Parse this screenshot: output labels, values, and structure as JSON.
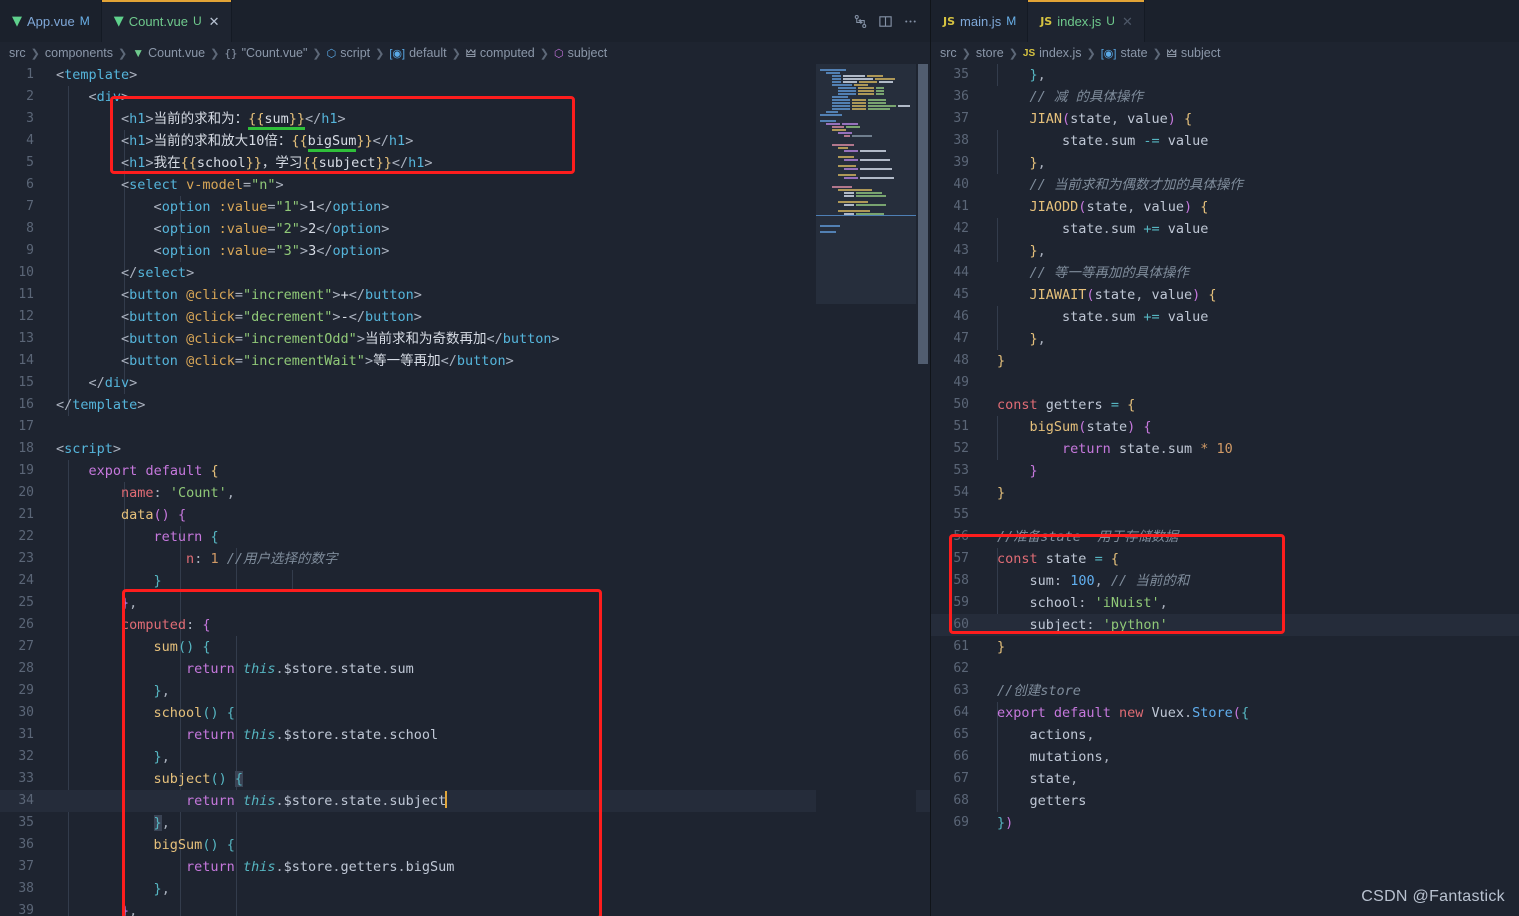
{
  "left_editor": {
    "tabs": [
      {
        "label": "App.vue",
        "icon": "vue-icon",
        "badge": "M",
        "badge_type": "modified",
        "active": false,
        "closable": false
      },
      {
        "label": "Count.vue",
        "icon": "vue-icon",
        "badge": "U",
        "badge_type": "untracked",
        "active": true,
        "closable": true
      }
    ],
    "actions": [
      {
        "name": "compare-changes-icon",
        "label": "Compare Changes"
      },
      {
        "name": "split-editor-icon",
        "label": "Split Editor"
      },
      {
        "name": "more-actions-icon",
        "label": "More Actions..."
      }
    ],
    "breadcrumb": [
      {
        "label": "src",
        "icon": "none"
      },
      {
        "label": "components",
        "icon": "none"
      },
      {
        "label": "Count.vue",
        "icon": "vue-icon"
      },
      {
        "label": "\"Count.vue\"",
        "icon": "braces-icon"
      },
      {
        "label": "script",
        "icon": "cube-icon"
      },
      {
        "label": "default",
        "icon": "object-icon"
      },
      {
        "label": "computed",
        "icon": "wrench-icon"
      },
      {
        "label": "subject",
        "icon": "field-icon"
      }
    ],
    "first_line": 1,
    "active_line": 34,
    "lines": [
      {
        "n": 1,
        "text": "<template>"
      },
      {
        "n": 2,
        "text": "    <div>"
      },
      {
        "n": 3,
        "text": "        <h1>当前的求和为：{{sum}}</h1>"
      },
      {
        "n": 4,
        "text": "        <h1>当前的求和放大10倍：{{bigSum}}</h1>"
      },
      {
        "n": 5,
        "text": "        <h1>我在{{school}}，学习{{subject}}</h1>"
      },
      {
        "n": 6,
        "text": "        <select v-model=\"n\">"
      },
      {
        "n": 7,
        "text": "            <option :value=\"1\">1</option>"
      },
      {
        "n": 8,
        "text": "            <option :value=\"2\">2</option>"
      },
      {
        "n": 9,
        "text": "            <option :value=\"3\">3</option>"
      },
      {
        "n": 10,
        "text": "        </select>"
      },
      {
        "n": 11,
        "text": "        <button @click=\"increment\">+</button>"
      },
      {
        "n": 12,
        "text": "        <button @click=\"decrement\">-</button>"
      },
      {
        "n": 13,
        "text": "        <button @click=\"incrementOdd\">当前求和为奇数再加</button>"
      },
      {
        "n": 14,
        "text": "        <button @click=\"incrementWait\">等一等再加</button>"
      },
      {
        "n": 15,
        "text": "    </div>"
      },
      {
        "n": 16,
        "text": "</template>"
      },
      {
        "n": 17,
        "text": ""
      },
      {
        "n": 18,
        "text": "<script>"
      },
      {
        "n": 19,
        "text": "    export default {"
      },
      {
        "n": 20,
        "text": "        name: 'Count',"
      },
      {
        "n": 21,
        "text": "        data() {"
      },
      {
        "n": 22,
        "text": "            return {"
      },
      {
        "n": 23,
        "text": "                n: 1 //用户选择的数字"
      },
      {
        "n": 24,
        "text": "            }"
      },
      {
        "n": 25,
        "text": "        },"
      },
      {
        "n": 26,
        "text": "        computed: {"
      },
      {
        "n": 27,
        "text": "            sum() {"
      },
      {
        "n": 28,
        "text": "                return this.$store.state.sum"
      },
      {
        "n": 29,
        "text": "            },"
      },
      {
        "n": 30,
        "text": "            school() {"
      },
      {
        "n": 31,
        "text": "                return this.$store.state.school"
      },
      {
        "n": 32,
        "text": "            },"
      },
      {
        "n": 33,
        "text": "            subject() {"
      },
      {
        "n": 34,
        "text": "                return this.$store.state.subject"
      },
      {
        "n": 35,
        "text": "            },"
      },
      {
        "n": 36,
        "text": "            bigSum() {"
      },
      {
        "n": 37,
        "text": "                return this.$store.getters.bigSum"
      },
      {
        "n": 38,
        "text": "            },"
      },
      {
        "n": 39,
        "text": "        },"
      }
    ],
    "annotations": [
      {
        "name": "template-interpolation-highlight-box",
        "color": "#fe1d1d"
      },
      {
        "name": "computed-block-highlight-box",
        "color": "#fe1d1d"
      }
    ],
    "green_underlines": [
      "sum",
      "bigSum",
      "school",
      "subject"
    ]
  },
  "right_editor": {
    "tabs": [
      {
        "label": "main.js",
        "icon": "js-icon",
        "badge": "M",
        "badge_type": "modified",
        "active": false,
        "closable": false
      },
      {
        "label": "index.js",
        "icon": "js-icon",
        "badge": "U",
        "badge_type": "untracked",
        "active": true,
        "closable": true
      }
    ],
    "breadcrumb": [
      {
        "label": "src",
        "icon": "none"
      },
      {
        "label": "store",
        "icon": "none"
      },
      {
        "label": "index.js",
        "icon": "js-icon"
      },
      {
        "label": "state",
        "icon": "object-icon"
      },
      {
        "label": "subject",
        "icon": "wrench-icon"
      }
    ],
    "first_line": 35,
    "active_line": 60,
    "lines": [
      {
        "n": 35,
        "text": "    },"
      },
      {
        "n": 36,
        "text": "    // 减 的具体操作"
      },
      {
        "n": 37,
        "text": "    JIAN(state, value) {"
      },
      {
        "n": 38,
        "text": "        state.sum -= value"
      },
      {
        "n": 39,
        "text": "    },"
      },
      {
        "n": 40,
        "text": "    // 当前求和为偶数才加的具体操作"
      },
      {
        "n": 41,
        "text": "    JIAODD(state, value) {"
      },
      {
        "n": 42,
        "text": "        state.sum += value"
      },
      {
        "n": 43,
        "text": "    },"
      },
      {
        "n": 44,
        "text": "    // 等一等再加的具体操作"
      },
      {
        "n": 45,
        "text": "    JIAWAIT(state, value) {"
      },
      {
        "n": 46,
        "text": "        state.sum += value"
      },
      {
        "n": 47,
        "text": "    },"
      },
      {
        "n": 48,
        "text": "}"
      },
      {
        "n": 49,
        "text": ""
      },
      {
        "n": 50,
        "text": "const getters = {"
      },
      {
        "n": 51,
        "text": "    bigSum(state) {"
      },
      {
        "n": 52,
        "text": "        return state.sum * 10"
      },
      {
        "n": 53,
        "text": "    }"
      },
      {
        "n": 54,
        "text": "}"
      },
      {
        "n": 55,
        "text": ""
      },
      {
        "n": 56,
        "text": "//准备state  用于存储数据"
      },
      {
        "n": 57,
        "text": "const state = {"
      },
      {
        "n": 58,
        "text": "    sum: 100, // 当前的和"
      },
      {
        "n": 59,
        "text": "    school: 'iNuist',"
      },
      {
        "n": 60,
        "text": "    subject: 'python'"
      },
      {
        "n": 61,
        "text": "}"
      },
      {
        "n": 62,
        "text": ""
      },
      {
        "n": 63,
        "text": "//创建store"
      },
      {
        "n": 64,
        "text": "export default new Vuex.Store({"
      },
      {
        "n": 65,
        "text": "    actions,"
      },
      {
        "n": 66,
        "text": "    mutations,"
      },
      {
        "n": 67,
        "text": "    state,"
      },
      {
        "n": 68,
        "text": "    getters"
      },
      {
        "n": 69,
        "text": "})"
      }
    ],
    "annotations": [
      {
        "name": "state-object-highlight-box",
        "color": "#fe1d1d"
      }
    ]
  },
  "watermark": {
    "text": "CSDN @Fantastick"
  },
  "theme": {
    "editor_background": "#1e2430",
    "tabbar_background": "#1b212c",
    "active_tab_border": "#e2a336",
    "annotation_color": "#fe1d1d",
    "underline_color": "#2fbf3a",
    "active_line_background": "#252c3a",
    "line_number_color": "#5b6677"
  }
}
